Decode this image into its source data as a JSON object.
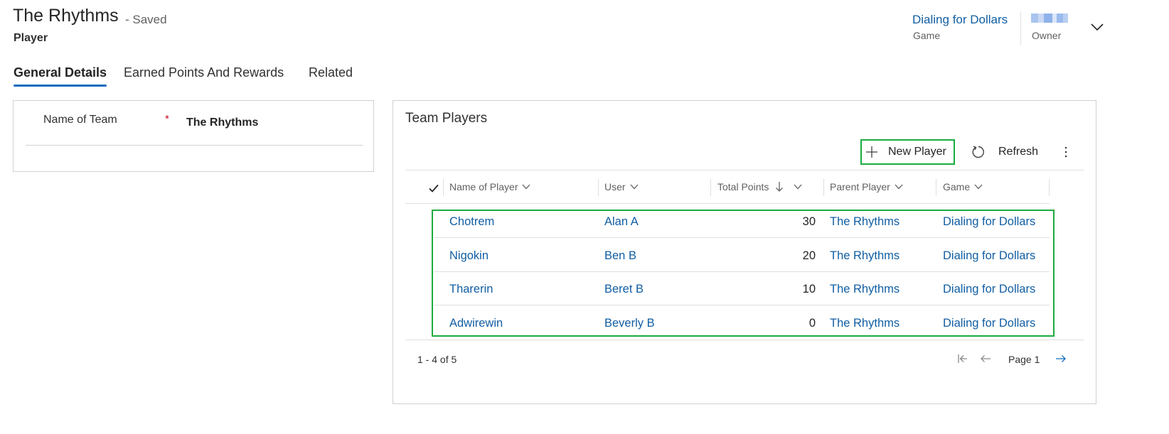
{
  "record": {
    "title": "The Rhythms",
    "saved_status": "- Saved",
    "entity": "Player"
  },
  "header_fields": {
    "game_value": "Dialing for Dollars",
    "game_label": "Game",
    "owner_label": "Owner"
  },
  "tabs": [
    {
      "label": "General Details",
      "active": true
    },
    {
      "label": "Earned Points And Rewards",
      "active": false
    },
    {
      "label": "Related",
      "active": false
    }
  ],
  "form": {
    "team_name_label": "Name of Team",
    "required_marker": "*",
    "team_name_value": "The Rhythms"
  },
  "subgrid": {
    "title": "Team Players",
    "commands": {
      "new_label": "New Player",
      "refresh_label": "Refresh"
    },
    "columns": [
      {
        "label": "Name of Player"
      },
      {
        "label": "User"
      },
      {
        "label": "Total Points",
        "sort": "descending"
      },
      {
        "label": "Parent Player"
      },
      {
        "label": "Game"
      }
    ],
    "rows": [
      {
        "name": "Chotrem",
        "user": "Alan A",
        "points": "30",
        "parent": "The Rhythms",
        "game": "Dialing for Dollars"
      },
      {
        "name": "Nigokin",
        "user": "Ben B",
        "points": "20",
        "parent": "The Rhythms",
        "game": "Dialing for Dollars"
      },
      {
        "name": "Tharerin",
        "user": "Beret B",
        "points": "10",
        "parent": "The Rhythms",
        "game": "Dialing for Dollars"
      },
      {
        "name": "Adwirewin",
        "user": "Beverly B",
        "points": "0",
        "parent": "The Rhythms",
        "game": "Dialing for Dollars"
      }
    ],
    "pager": {
      "status": "1 - 4 of 5",
      "page_label": "Page 1"
    }
  },
  "colors": {
    "accent": "#0f6cbd",
    "link": "#115ea3",
    "highlight_box": "#1aab40",
    "required": "#c50f1f"
  },
  "icons": [
    "chevron-down-icon",
    "plus-icon",
    "refresh-icon",
    "more-vertical-icon",
    "checkmark-icon",
    "sort-down-arrow-icon",
    "first-page-icon",
    "previous-page-icon",
    "next-page-icon"
  ]
}
